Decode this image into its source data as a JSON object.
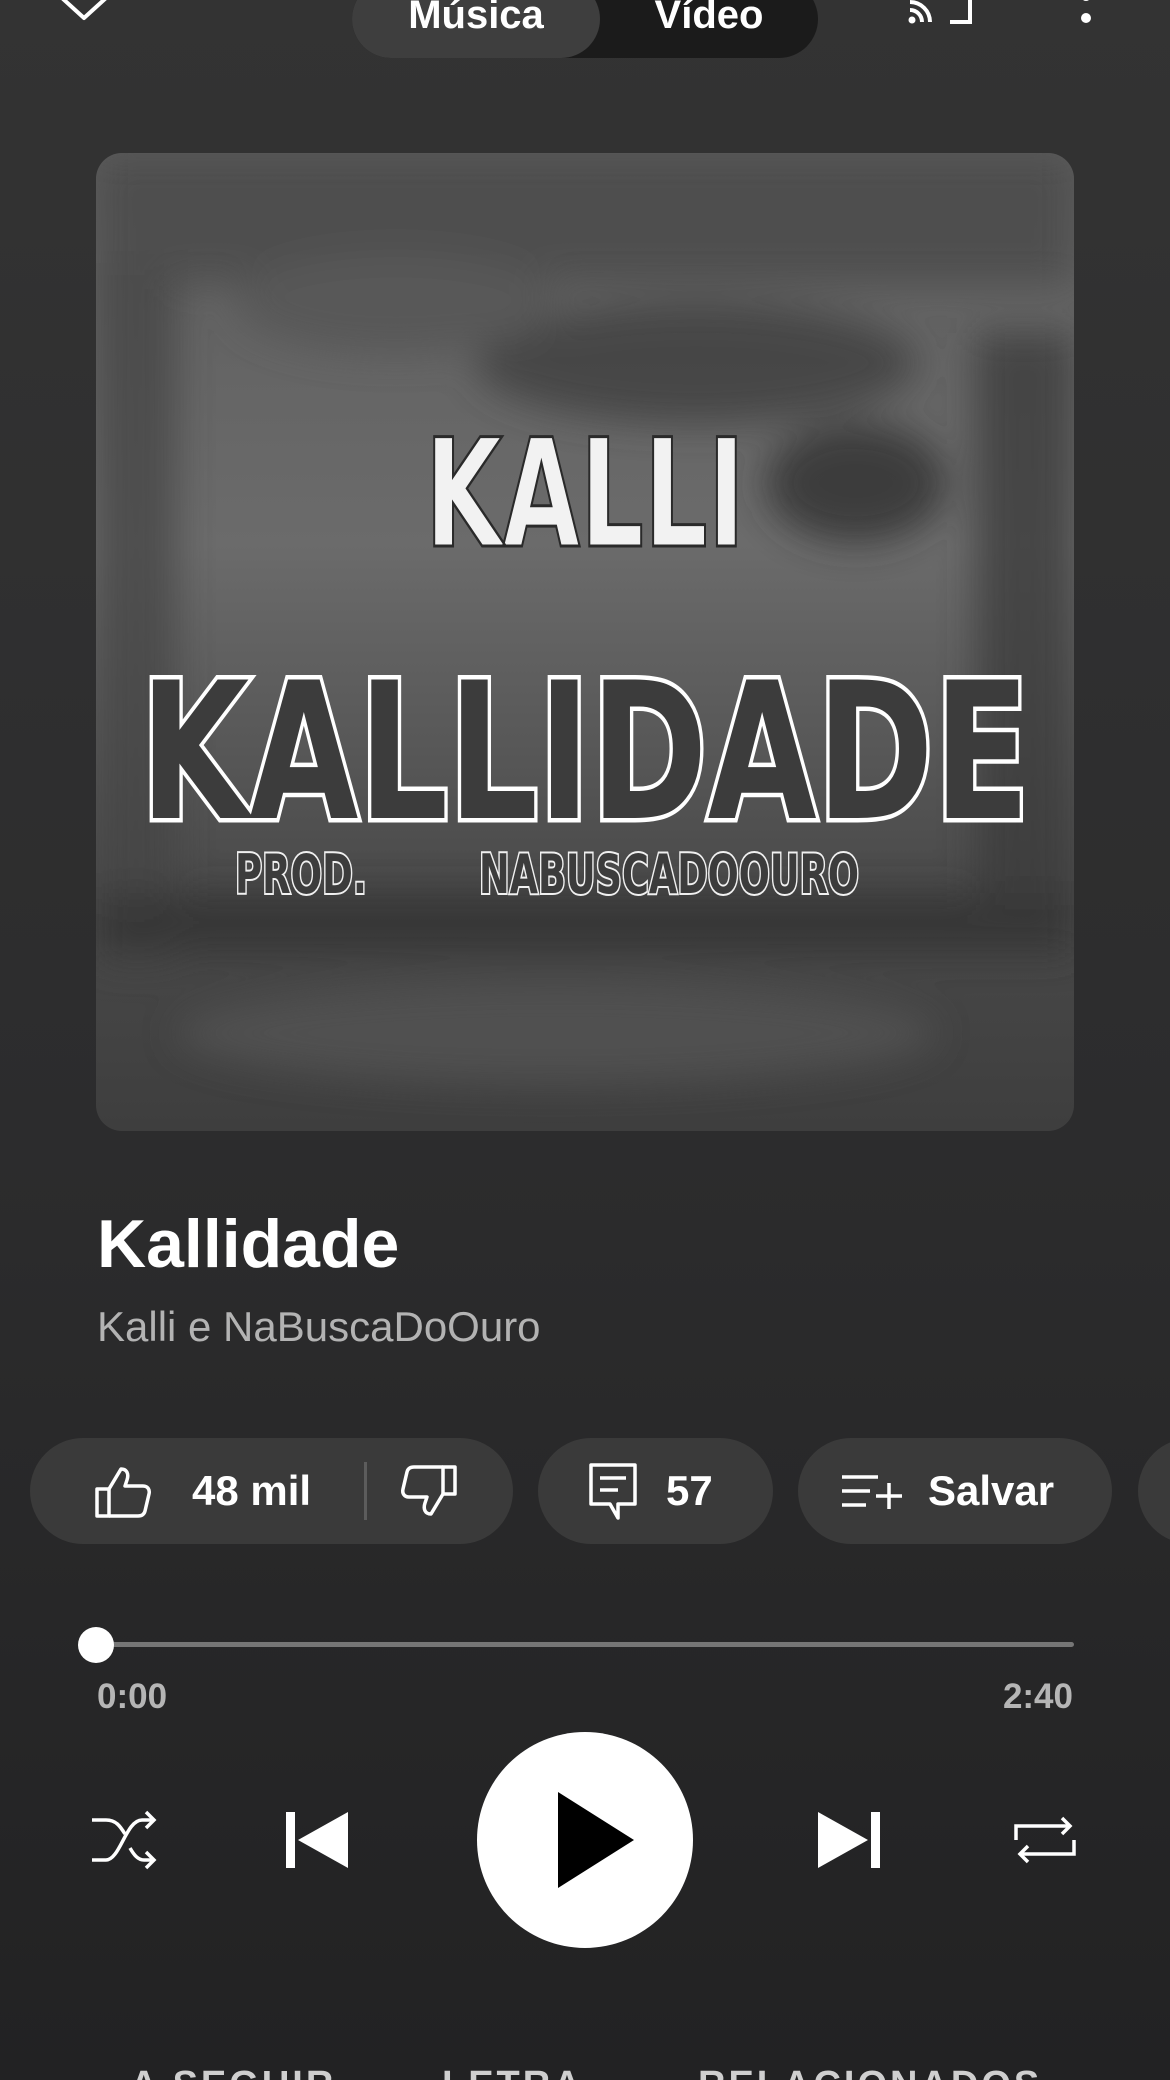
{
  "header": {
    "mode_switch": {
      "music_label": "Música",
      "video_label": "Vídeo",
      "selected": "Música"
    },
    "icons": [
      "chevron-down-icon",
      "cast-icon",
      "more-vertical-icon"
    ]
  },
  "artwork": {
    "line1": "KALLI",
    "line2": "KALLIDADE",
    "line3a": "PROD.",
    "line3b": "NABUSCADOOURO"
  },
  "track": {
    "title": "Kallidade",
    "artist": "Kalli e NaBuscaDoOuro"
  },
  "actions": {
    "likes": "48 mil",
    "comments": "57",
    "save_label": "Salvar"
  },
  "player": {
    "elapsed": "0:00",
    "total": "2:40",
    "progress_percent": 0
  },
  "tabs": [
    "A SEGUIR",
    "LETRA",
    "RELACIONADOS"
  ],
  "colors": {
    "background": "#2c2c2d",
    "chip": "#3a3a3a",
    "secondary_text": "#b3b3b3",
    "play_button": "#ffffff"
  }
}
